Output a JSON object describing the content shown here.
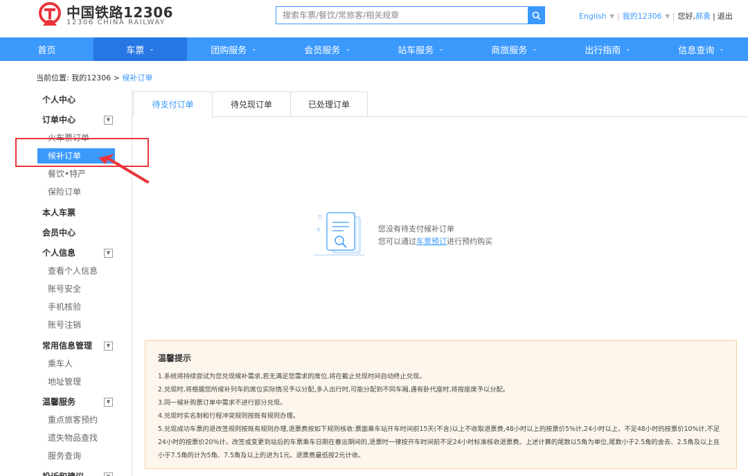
{
  "header": {
    "brand_cn": "中国铁路12306",
    "brand_en": "12306 CHINA RAILWAY",
    "search_placeholder": "搜索车票/餐饮/常旅客/相关规章",
    "lang": "English",
    "my12306": "我的12306",
    "greeting": "您好,",
    "username": "郝勇",
    "separator": "|",
    "logout": "退出"
  },
  "nav": {
    "items": [
      {
        "label": "首页",
        "has_caret": false
      },
      {
        "label": "车票",
        "has_caret": true
      },
      {
        "label": "团购服务",
        "has_caret": true
      },
      {
        "label": "会员服务",
        "has_caret": true
      },
      {
        "label": "站车服务",
        "has_caret": true
      },
      {
        "label": "商旅服务",
        "has_caret": true
      },
      {
        "label": "出行指南",
        "has_caret": true
      },
      {
        "label": "信息查询",
        "has_caret": true
      }
    ],
    "caret_glyph": "⌄"
  },
  "breadcrumb": {
    "prefix": "当前位置:",
    "parent": "我的12306",
    "arrow": ">",
    "current": "候补订单"
  },
  "sidebar": {
    "personal_center": "个人中心",
    "order_center": "订单中心",
    "order_items": [
      "火车票订单",
      "候补订单",
      "餐饮•特产",
      "保险订单"
    ],
    "my_tickets": "本人车票",
    "member_center": "会员中心",
    "personal_info": "个人信息",
    "info_items": [
      "查看个人信息",
      "账号安全",
      "手机核验",
      "账号注销"
    ],
    "common_info": "常用信息管理",
    "common_items": [
      "乘车人",
      "地址管理"
    ],
    "warm_service": "温馨服务",
    "service_items": [
      "重点旅客预约",
      "遗失物品查找",
      "服务查询"
    ],
    "complaint": "投诉和建议"
  },
  "tabs": [
    "待支付订单",
    "待兑现订单",
    "已处理订单"
  ],
  "empty": {
    "line1": "您没有待支付候补订单",
    "line2_prefix": "您可以通过",
    "line2_link": "车票预订",
    "line2_suffix": "进行预约购买"
  },
  "tips": {
    "title": "温馨提示",
    "items": [
      "1.系统将持续尝试为您兑现候补需求,若无满足您需求的席位,将在截止兑现时间自动终止兑现。",
      "2.兑现时,将根据您所候补列车的席位实际情况予以分配,多人出行时,可能分配到不同车厢,遇有卧代座时,将按座席予以分配。",
      "3.同一候补购票订单中需求不进行部分兑现。",
      "4.兑现时实名制和行程冲突规则按既有规则办理。",
      "5.兑现成功车票的退改签规则按既有规则办理,退票费按如下规则核收:票面乘车站开车时间前15天(不含)以上不收取退票费,48小时以上的按票价5%计,24小时以上、不足48小时的按票价10%计,不足24小时的按票价20%计。改签或变更到站后的车票乘车日期在春运期间的,退票时一律按开车时间前不足24小时标准核收退票费。上述计算的尾数以5角为单位,尾数小于2.5角的舍去、2.5角及以上且小于7.5角的计为5角、7.5角及以上的进为1元。退票费最低按2元计收。"
    ]
  },
  "colors": {
    "brand_blue": "#3b99fc",
    "nav_active": "#2676e3",
    "annotation_red": "#e8343b",
    "tips_bg": "#fdf6ec"
  }
}
